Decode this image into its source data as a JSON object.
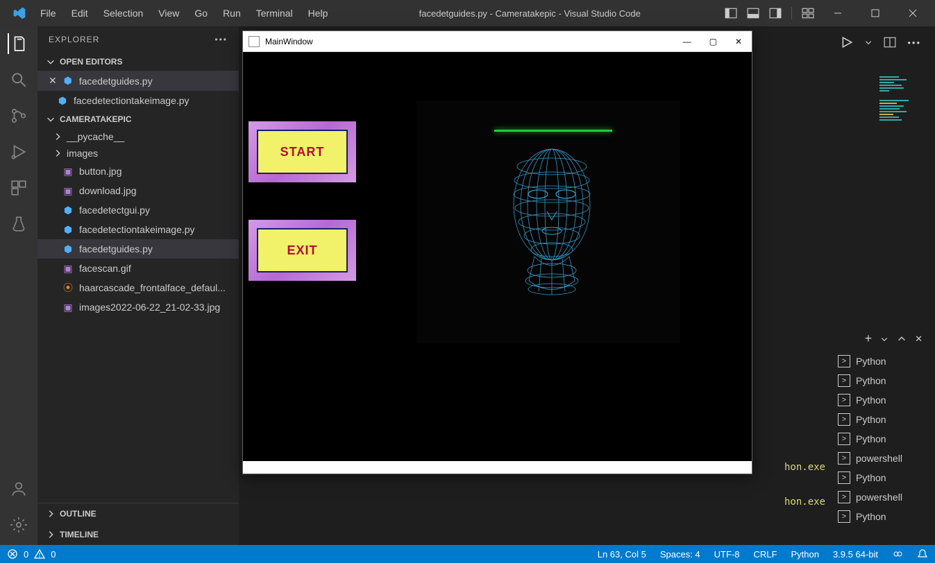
{
  "menu": [
    "File",
    "Edit",
    "Selection",
    "View",
    "Go",
    "Run",
    "Terminal",
    "Help"
  ],
  "title": "facedetguides.py - Cameratakepic - Visual Studio Code",
  "explorer": {
    "title": "EXPLORER",
    "openEditors": "OPEN EDITORS",
    "editors": [
      {
        "label": "facedetguides.py",
        "active": true,
        "close": true
      },
      {
        "label": "facedetectiontakeimage.py",
        "active": false,
        "close": false
      }
    ],
    "project": "CAMERATAKEPIC",
    "folders": [
      "__pycache__",
      "images"
    ],
    "files": [
      {
        "label": "button.jpg",
        "type": "img"
      },
      {
        "label": "download.jpg",
        "type": "img"
      },
      {
        "label": "facedetectgui.py",
        "type": "py"
      },
      {
        "label": "facedetectiontakeimage.py",
        "type": "py"
      },
      {
        "label": "facedetguides.py",
        "type": "py",
        "active": true
      },
      {
        "label": "facescan.gif",
        "type": "img"
      },
      {
        "label": "haarcascade_frontalface_defaul...",
        "type": "rss"
      },
      {
        "label": "images2022-06-22_21-02-33.jpg",
        "type": "img"
      }
    ],
    "bottom": [
      "OUTLINE",
      "TIMELINE"
    ]
  },
  "terminals": [
    "Python",
    "Python",
    "Python",
    "Python",
    "Python",
    "powershell",
    "Python",
    "powershell",
    "Python"
  ],
  "terminal_lines": [
    "hon.exe",
    "hon.exe"
  ],
  "status": {
    "errors": "0",
    "warnings": "0",
    "lncol": "Ln 63, Col 5",
    "spaces": "Spaces: 4",
    "encoding": "UTF-8",
    "eol": "CRLF",
    "lang": "Python",
    "pyver": "3.9.5 64-bit"
  },
  "mainwindow": {
    "title": "MainWindow",
    "buttons": {
      "start": "START",
      "exit": "EXIT"
    }
  }
}
